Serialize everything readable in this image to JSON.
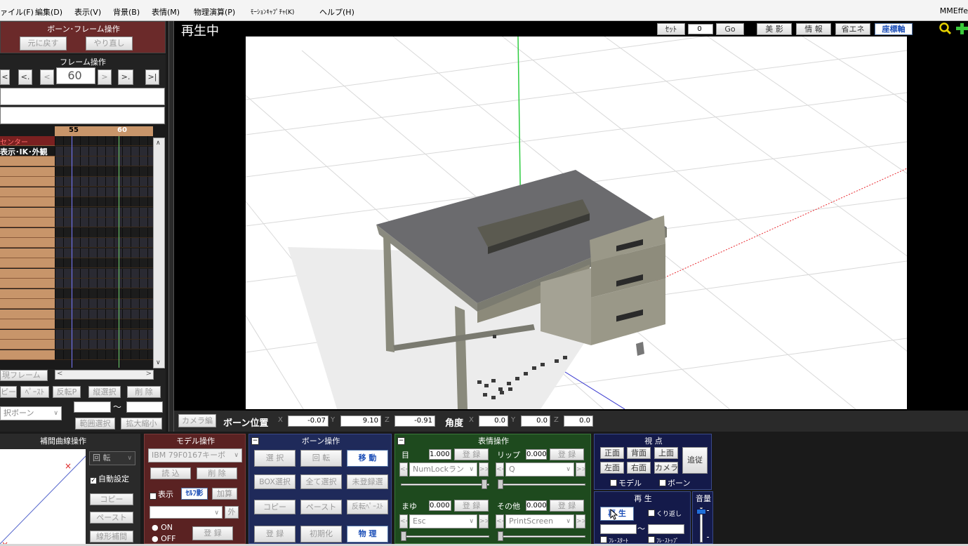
{
  "menu": [
    "ァイル(F)",
    "編集(D)",
    "表示(V)",
    "背景(B)",
    "表情(M)",
    "物理演算(P)",
    "ﾓｰｼｮﾝｷｬﾌﾟﾁｬ(K)",
    "ヘルプ(H)"
  ],
  "app_title": "MMEffe",
  "viewport": {
    "status": "再生中",
    "set_label": "ｾｯﾄ",
    "set_value": "0",
    "go_label": "Go",
    "bieikei": "美 影",
    "info": "情 報",
    "save_energy": "省エネ",
    "axis": "座標軸",
    "coord_bar": {
      "camera_btn": "カメラ編",
      "bone_pos": "ボーン位置",
      "x": "-0.07",
      "y": "9.10",
      "z": "-0.91",
      "angle": "角度",
      "ax": "0.0",
      "ay": "0.0",
      "az": "0.0",
      "lx": "X",
      "ly": "Y",
      "lz": "Z"
    }
  },
  "left": {
    "bone_frame_title": "ボーン･フレーム操作",
    "undo": "元に戻す",
    "redo": "やり直し",
    "frame_title": "フレーム操作",
    "frame_value": "60",
    "nav": [
      "<",
      "<.",
      "<",
      ">",
      ">.",
      ">|"
    ],
    "timeline": {
      "marks": [
        "55",
        "60"
      ],
      "rows": [
        "センター",
        "表示･IK･外観"
      ]
    },
    "current_frame": "現フレーム",
    "copy": "ピー",
    "paste": "ﾍﾟｰｽﾄ",
    "reverse": "反転P",
    "vert_select": "縦選択",
    "delete": "削 除",
    "bone_select": "択ボーン",
    "range_select": "範囲選択",
    "zoom": "拡大縮小",
    "tilde": "～"
  },
  "interp": {
    "title": "補間曲線操作",
    "rotate": "回 転",
    "auto": "自動設定",
    "copy": "コピー",
    "paste": "ペースト",
    "linear": "線形補間"
  },
  "model": {
    "title": "モデル操作",
    "model_name": "IBM 79F0167キーボ",
    "load": "読 込",
    "delete": "削 除",
    "show": "表示",
    "self_shadow": "ｾﾙﾌ影",
    "add": "加算",
    "outside": "外",
    "on": "ON",
    "off": "OFF",
    "register": "登 録"
  },
  "bone": {
    "title": "ボーン操作",
    "select": "選 択",
    "rotate": "回 転",
    "move": "移 動",
    "box_select": "BOX選択",
    "select_all": "全て選択",
    "unregistered": "未登録選",
    "copy": "コピー",
    "paste": "ペースト",
    "reverse_paste": "反転ﾍﾟｰｽﾄ",
    "register": "登 録",
    "initialize": "初期化",
    "physics": "物 理"
  },
  "face": {
    "title": "表情操作",
    "eye": "目",
    "eye_val": "1.000",
    "lip": "リップ",
    "lip_val": "0.000",
    "register": "登 録",
    "lip_sel": "NumLockラン",
    "q_sel": "Q",
    "brow": "まゆ",
    "brow_val": "0.000",
    "other": "その他",
    "other_val": "0.000",
    "esc_sel": "Esc",
    "ps_sel": "PrintScreen"
  },
  "view": {
    "title": "視 点",
    "front": "正面",
    "back": "背面",
    "top": "上面",
    "follow": "追従",
    "left": "左面",
    "right": "右面",
    "camera": "カメラ",
    "model_chk": "モデル",
    "bone_chk": "ボーン"
  },
  "play": {
    "title": "再 生",
    "play": "再 生",
    "repeat": "くり返し",
    "frame_start": "ﾌﾚ･ｽﾀｰﾄ",
    "frame_stop": "ﾌﾚ･ｽﾄｯﾌﾟ",
    "tilde": "～"
  },
  "volume": {
    "title": "音量"
  }
}
